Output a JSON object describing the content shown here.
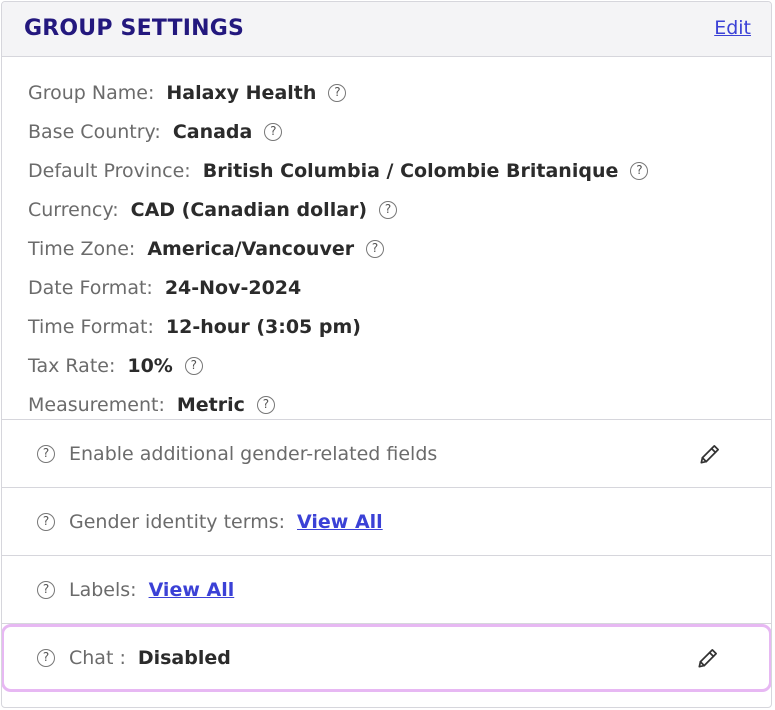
{
  "header": {
    "title": "GROUP SETTINGS",
    "edit_label": "Edit"
  },
  "settings": [
    {
      "label": "Group Name:",
      "value": "Halaxy Health",
      "help": true
    },
    {
      "label": "Base Country:",
      "value": "Canada",
      "help": true
    },
    {
      "label": "Default Province:",
      "value": "British Columbia / Colombie Britanique",
      "help": true
    },
    {
      "label": "Currency:",
      "value": "CAD (Canadian dollar)",
      "help": true
    },
    {
      "label": "Time Zone:",
      "value": "America/Vancouver",
      "help": true
    },
    {
      "label": "Date Format:",
      "value": "24-Nov-2024",
      "help": false
    },
    {
      "label": "Time Format:",
      "value": "12-hour (3:05 pm)",
      "help": false
    },
    {
      "label": "Tax Rate:",
      "value": "10%",
      "help": true
    },
    {
      "label": "Measurement:",
      "value": "Metric",
      "help": true
    }
  ],
  "sections": {
    "gender_fields": {
      "label": "Enable additional gender-related fields"
    },
    "gender_terms": {
      "label": "Gender identity terms:",
      "link": "View All"
    },
    "labels": {
      "label": "Labels:",
      "link": "View All"
    },
    "chat": {
      "label": "Chat :",
      "value": "Disabled"
    }
  },
  "help_glyph": "?",
  "icons": [
    "help-icon",
    "pencil-icon"
  ],
  "colors": {
    "title": "#23187e",
    "link": "#3b41d6",
    "highlight_border": "#e7b8f3"
  }
}
